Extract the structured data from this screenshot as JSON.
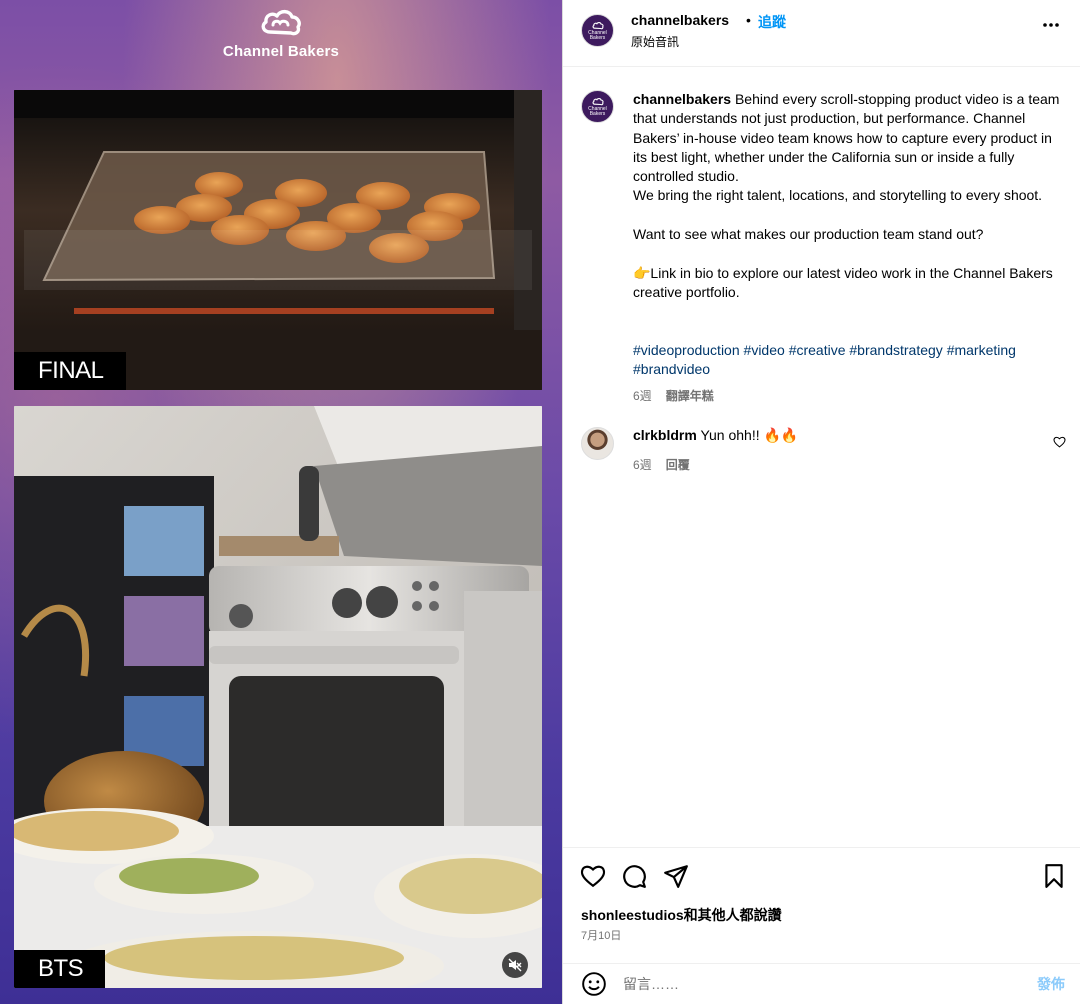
{
  "media": {
    "brand_name": "Channel Bakers",
    "top_tag": "FINAL",
    "bottom_tag": "BTS",
    "accent_colors": {
      "background_top": "#8e5aa3",
      "background_bottom": "#3e2f95"
    }
  },
  "header": {
    "username": "channelbakers",
    "separator": "•",
    "follow_label": "追蹤",
    "audio_label": "原始音訊",
    "avatar_text": "Channel Bakers"
  },
  "caption": {
    "username": "channelbakers",
    "text": " Behind every scroll-stopping product video is a team that understands not just production, but performance. Channel Bakers’ in-house video team knows how to capture every product in its best light, whether under the California sun or inside a fully controlled studio.\nWe bring the right talent, locations, and storytelling to every shoot.\n\nWant to see what makes our production team stand out?\n\n👉Link in bio to explore our latest video work in the Channel Bakers creative portfolio.",
    "hashtags": [
      "#videoproduction",
      "#video",
      "#creative",
      "#brandstrategy",
      "#marketing",
      "#brandvideo"
    ],
    "age": "6週",
    "translate_label": "翻譯年糕"
  },
  "comment": {
    "username": "clrkbldrm",
    "text": " Yun ohh!! 🔥🔥",
    "age": "6週",
    "reply_label": "回覆"
  },
  "actions": {
    "likes_text": "shonleestudios和其他人都說讚",
    "date": "7月10日"
  },
  "composer": {
    "placeholder": "留言……",
    "post_label": "發佈"
  },
  "icons": [
    "more-icon",
    "heart-icon",
    "comment-icon",
    "share-icon",
    "bookmark-icon",
    "emoji-icon",
    "mute-icon"
  ],
  "colors": {
    "link_blue": "#0095f6",
    "hashtag": "#00376b",
    "muted": "#737373",
    "post_disabled": "#8ccbfb"
  }
}
